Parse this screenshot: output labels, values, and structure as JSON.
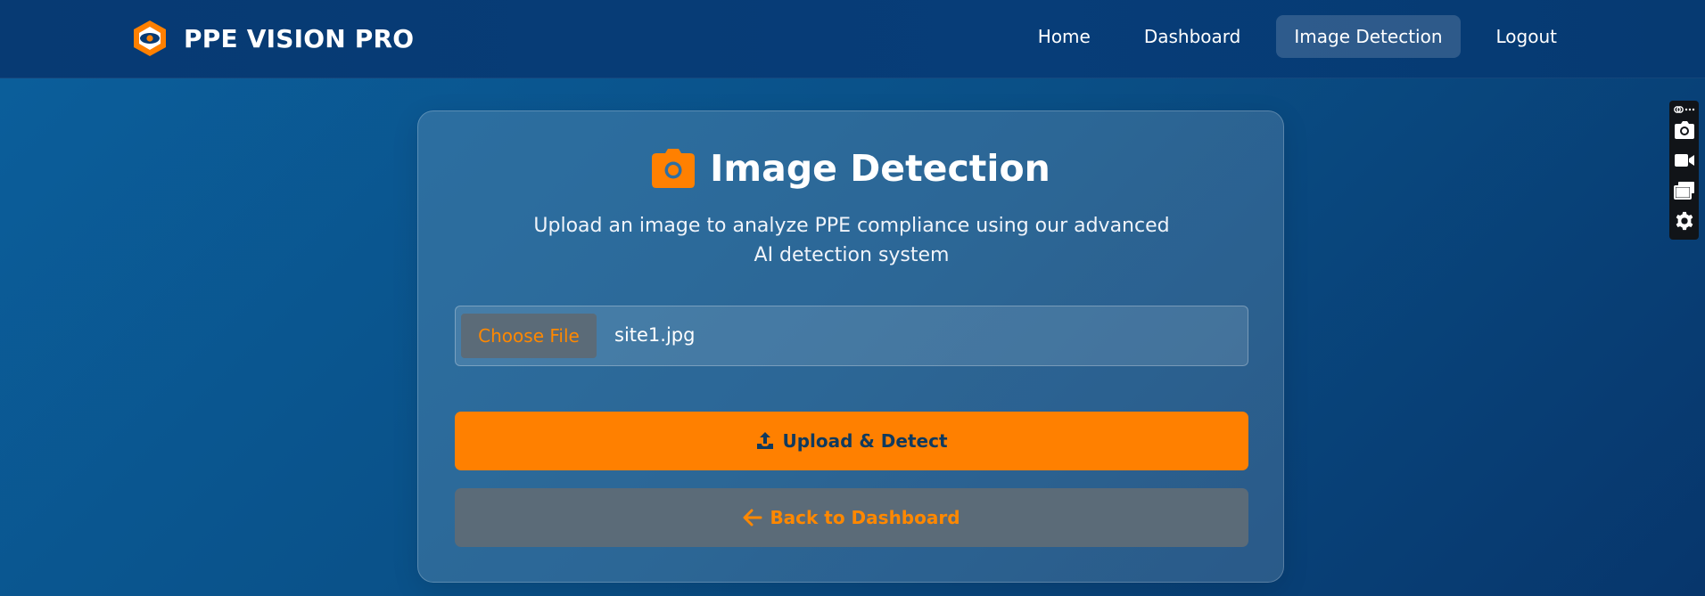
{
  "app": {
    "brand_name": "PPE VISION PRO",
    "logo_icon": "hex-eye-logo-icon"
  },
  "nav": {
    "items": [
      {
        "label": "Home",
        "active": false
      },
      {
        "label": "Dashboard",
        "active": false
      },
      {
        "label": "Image Detection",
        "active": true
      },
      {
        "label": "Logout",
        "active": false
      }
    ]
  },
  "card": {
    "title_icon": "camera-icon",
    "title": "Image Detection",
    "subtitle": "Upload an image to analyze PPE compliance using our advanced AI detection system",
    "file_input": {
      "button_label": "Choose File",
      "file_name": "site1.jpg"
    },
    "upload_button": {
      "icon": "upload-icon",
      "label": "Upload & Detect"
    },
    "back_button": {
      "icon": "arrow-left-icon",
      "label": "Back to Dashboard"
    }
  },
  "side_toolbar": {
    "items": [
      "link-more-icon",
      "camera-icon",
      "video-icon",
      "windows-icon",
      "gear-icon"
    ]
  },
  "colors": {
    "accent": "#ff8000",
    "navbar": "#073a73",
    "background": "#0a4f86",
    "secondary_button": "#5b6b78",
    "upload_text": "#103a5e"
  }
}
